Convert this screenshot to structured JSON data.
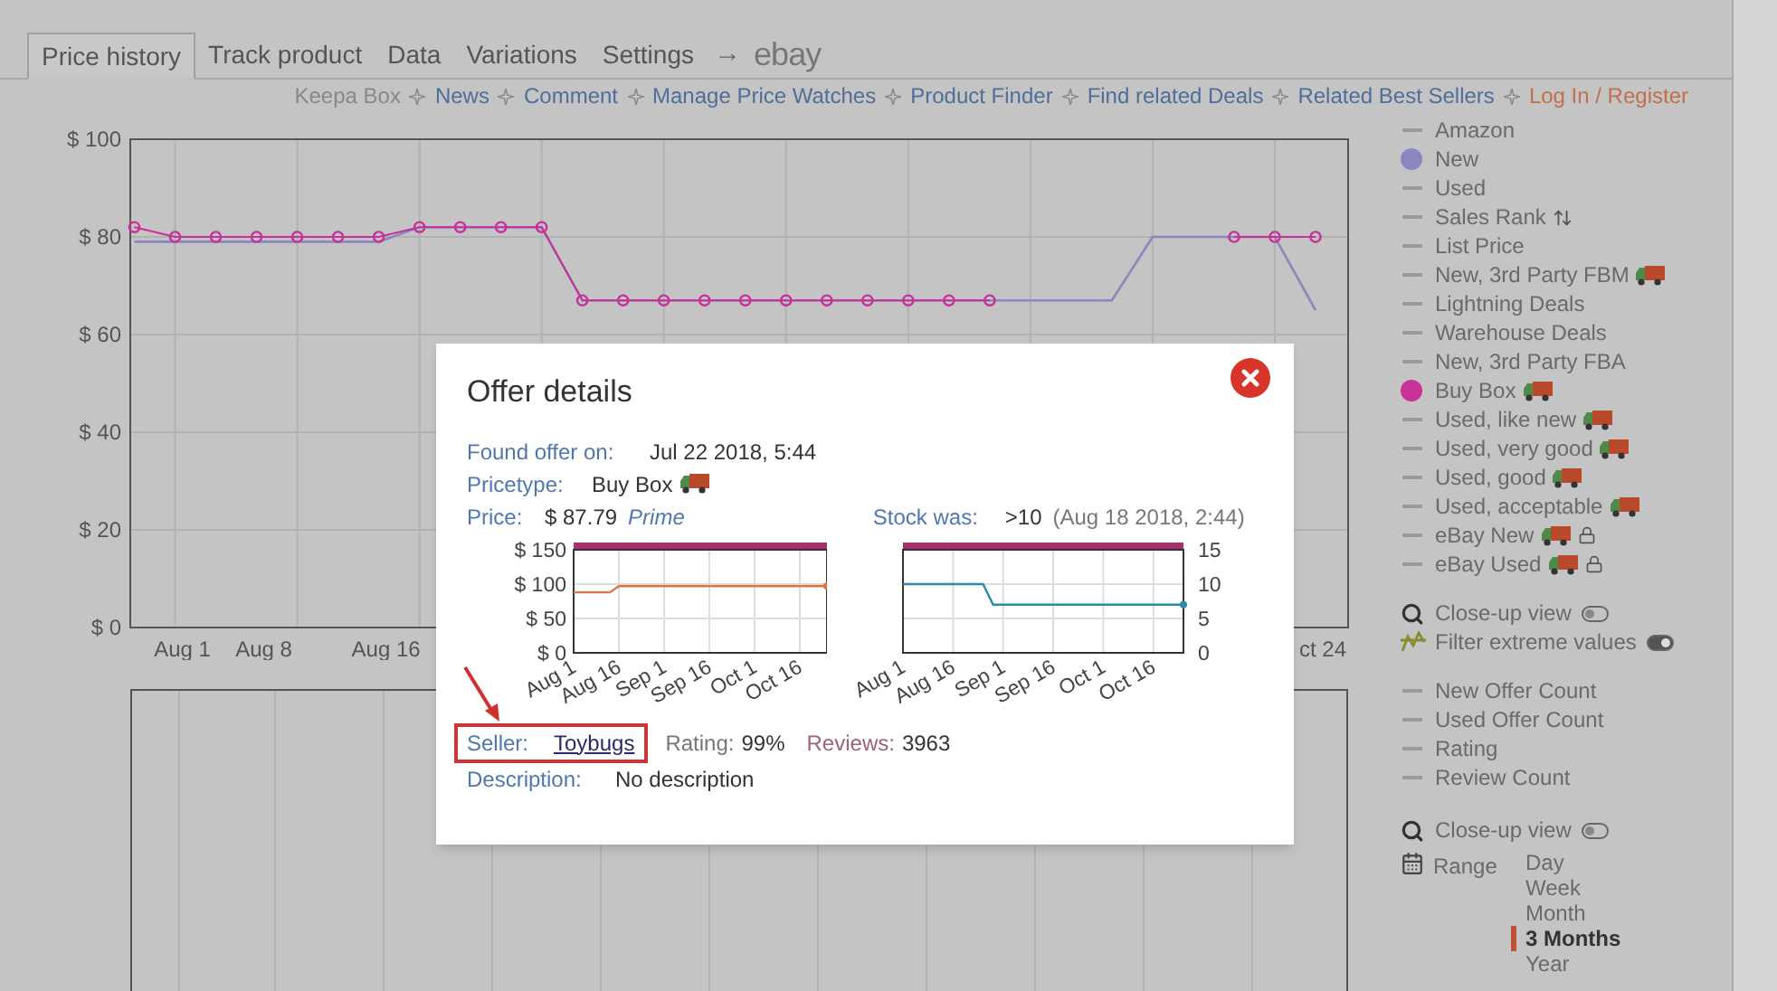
{
  "tabs": [
    {
      "label": "Price history",
      "selected": true
    },
    {
      "label": "Track product",
      "selected": false
    },
    {
      "label": "Data",
      "selected": false
    },
    {
      "label": "Variations",
      "selected": false
    },
    {
      "label": "Settings",
      "selected": false
    }
  ],
  "ebay": {
    "arrow": "→",
    "label": "ebay"
  },
  "links": [
    {
      "label": "Keepa Box",
      "kind": "muted"
    },
    {
      "label": "News",
      "kind": "link"
    },
    {
      "label": "Comment",
      "kind": "link"
    },
    {
      "label": "Manage Price Watches",
      "kind": "link"
    },
    {
      "label": "Product Finder",
      "kind": "link"
    },
    {
      "label": "Find related Deals",
      "kind": "link"
    },
    {
      "label": "Related Best Sellers",
      "kind": "link"
    },
    {
      "label": "Log In / Register",
      "kind": "account"
    }
  ],
  "price_chart": {
    "chart_data": {
      "type": "line",
      "categories": [
        null,
        "Aug 1",
        null,
        "Aug 8",
        null,
        null,
        "Aug 16",
        null,
        null,
        null,
        null,
        null,
        null,
        null,
        null,
        null,
        null,
        null,
        null,
        null,
        null,
        null,
        null,
        null,
        null,
        null,
        null,
        null,
        null,
        "ct 24"
      ],
      "ylim": [
        0,
        100
      ],
      "grid": true,
      "yticks": [
        {
          "value": 0,
          "label": "$ 0"
        },
        {
          "value": 20,
          "label": "$ 20"
        },
        {
          "value": 40,
          "label": "$ 40"
        },
        {
          "value": 60,
          "label": "$ 60"
        },
        {
          "value": 80,
          "label": "$ 80"
        },
        {
          "value": 100,
          "label": "$ 100"
        }
      ],
      "series": [
        {
          "color": "#8a86c0",
          "values": [
            79,
            79,
            79,
            79,
            79,
            79,
            79,
            82,
            82,
            82,
            82,
            67,
            67,
            67,
            67,
            67,
            67,
            67,
            67,
            67,
            67,
            67,
            67,
            67,
            67,
            80,
            80,
            80,
            80,
            65
          ]
        },
        {
          "color": "#c8309a",
          "marker": true,
          "values": [
            82,
            80,
            80,
            80,
            80,
            80,
            80,
            82,
            82,
            82,
            82,
            67,
            67,
            67,
            67,
            67,
            67,
            67,
            67,
            67,
            67,
            67,
            null,
            null,
            null,
            null,
            null,
            80,
            80,
            80
          ]
        }
      ]
    }
  },
  "legend": [
    {
      "label": "Amazon",
      "kind": "line",
      "truck": false,
      "lock": false,
      "sort": false
    },
    {
      "label": "New",
      "kind": "dot",
      "color": "#8a86c0",
      "truck": false,
      "lock": false,
      "sort": false
    },
    {
      "label": "Used",
      "kind": "line",
      "truck": false,
      "lock": false,
      "sort": false
    },
    {
      "label": "Sales Rank",
      "kind": "line",
      "truck": false,
      "lock": false,
      "sort": true
    },
    {
      "label": "List Price",
      "kind": "line",
      "truck": false,
      "lock": false,
      "sort": false
    },
    {
      "label": "New, 3rd Party FBM",
      "kind": "line",
      "truck": true,
      "lock": false,
      "sort": false
    },
    {
      "label": "Lightning Deals",
      "kind": "line",
      "truck": false,
      "lock": false,
      "sort": false
    },
    {
      "label": "Warehouse Deals",
      "kind": "line",
      "truck": false,
      "lock": false,
      "sort": false
    },
    {
      "label": "New, 3rd Party FBA",
      "kind": "line",
      "truck": false,
      "lock": false,
      "sort": false
    },
    {
      "label": "Buy Box",
      "kind": "dot",
      "color": "#c8309a",
      "truck": true,
      "lock": false,
      "sort": false
    },
    {
      "label": "Used, like new",
      "kind": "line",
      "truck": true,
      "lock": false,
      "sort": false
    },
    {
      "label": "Used, very good",
      "kind": "line",
      "truck": true,
      "lock": false,
      "sort": false
    },
    {
      "label": "Used, good",
      "kind": "line",
      "truck": true,
      "lock": false,
      "sort": false
    },
    {
      "label": "Used, acceptable",
      "kind": "line",
      "truck": true,
      "lock": false,
      "sort": false
    },
    {
      "label": "eBay New",
      "kind": "line",
      "truck": true,
      "lock": true,
      "sort": false
    },
    {
      "label": "eBay Used",
      "kind": "line",
      "truck": true,
      "lock": true,
      "sort": false
    }
  ],
  "options": [
    {
      "label": "Close-up view",
      "kind": "zoom",
      "on": false
    },
    {
      "label": "Filter extreme values",
      "kind": "filter",
      "on": true
    }
  ],
  "legend_2": [
    {
      "label": "New Offer Count",
      "kind": "line"
    },
    {
      "label": "Used Offer Count",
      "kind": "line"
    },
    {
      "label": "Rating",
      "kind": "line"
    },
    {
      "label": "Review Count",
      "kind": "line"
    }
  ],
  "options_2": [
    {
      "label": "Close-up view",
      "kind": "zoom",
      "on": false
    }
  ],
  "range": {
    "label": "Range",
    "options": [
      {
        "label": "Day",
        "selected": false
      },
      {
        "label": "Week",
        "selected": false
      },
      {
        "label": "Month",
        "selected": false
      },
      {
        "label": "3 Months",
        "selected": true
      },
      {
        "label": "Year",
        "selected": false
      }
    ]
  },
  "dialog": {
    "title": "Offer details",
    "found": {
      "label": "Found offer on:",
      "value": "Jul 22 2018, 5:44"
    },
    "pricetype": {
      "label": "Pricetype:",
      "value": "Buy Box"
    },
    "price": {
      "label": "Price:",
      "value": "$ 87.79",
      "note": "Prime"
    },
    "stock": {
      "label": "Stock was:",
      "value": ">10",
      "note": "(Aug 18 2018, 2:44)"
    },
    "price_chart": {
      "chart_data": {
        "type": "line",
        "categories": [
          "Aug 1",
          null,
          null,
          null,
          null,
          "Aug 16",
          null,
          null,
          null,
          null,
          "Sep 1",
          null,
          null,
          null,
          null,
          "Sep 16",
          null,
          null,
          null,
          null,
          "Oct 1",
          null,
          null,
          null,
          null,
          "Oct 16",
          null,
          null,
          null
        ],
        "ylim": [
          0,
          150
        ],
        "grid": true,
        "yticks": [
          {
            "value": 0,
            "label": "$ 0"
          },
          {
            "value": 50,
            "label": "$ 50"
          },
          {
            "value": 100,
            "label": "$ 100"
          },
          {
            "value": 150,
            "label": "$ 150"
          }
        ],
        "series": [
          {
            "color": "#e0743a",
            "values": [
              88,
              88,
              88,
              88,
              88,
              97,
              97,
              97,
              97,
              97,
              97,
              97,
              97,
              97,
              97,
              97,
              97,
              97,
              97,
              97,
              97,
              97,
              97,
              97,
              97,
              97,
              97,
              97,
              97
            ]
          }
        ]
      }
    },
    "stock_chart": {
      "chart_data": {
        "type": "line",
        "categories": [
          "Aug 1",
          null,
          null,
          null,
          null,
          "Aug 16",
          null,
          null,
          null,
          null,
          "Sep 1",
          null,
          null,
          null,
          null,
          "Sep 16",
          null,
          null,
          null,
          null,
          "Oct 1",
          null,
          null,
          null,
          null,
          "Oct 16",
          null,
          null,
          null
        ],
        "ylim": [
          0,
          15
        ],
        "grid": true,
        "yticks": [
          0,
          5,
          10,
          15
        ],
        "series": [
          {
            "color": "#2a8aaa",
            "values": [
              10,
              10,
              10,
              10,
              10,
              10,
              10,
              10,
              10,
              7,
              7,
              7,
              7,
              7,
              7,
              7,
              7,
              7,
              7,
              7,
              7,
              7,
              7,
              7,
              7,
              7,
              7,
              7,
              7
            ]
          }
        ]
      }
    },
    "seller": {
      "label": "Seller:",
      "value": "Toybugs"
    },
    "rating": {
      "label": "Rating:",
      "value": "99%"
    },
    "reviews": {
      "label": "Reviews:",
      "value": "3963"
    },
    "description": {
      "label": "Description:",
      "value": "No description"
    }
  }
}
